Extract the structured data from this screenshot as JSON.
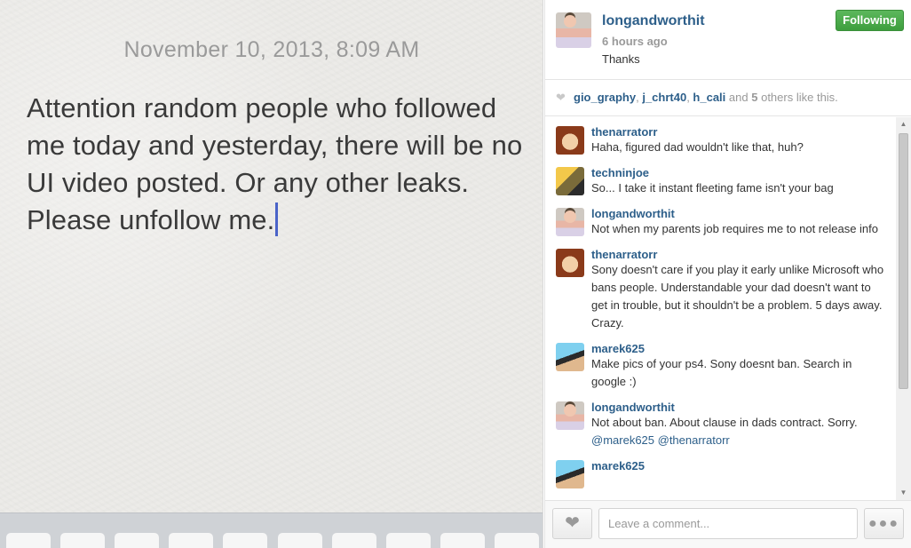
{
  "photo": {
    "date": "November 10, 2013, 8:09 AM",
    "note_text": "Attention random people who followed me today and yesterday, there will be no UI video posted. Or any other leaks. Please unfollow me."
  },
  "post": {
    "username": "longandworthit",
    "time_ago": "6 hours ago",
    "caption": "Thanks",
    "follow_label": "Following"
  },
  "likes": {
    "heart_icon": "heart-icon",
    "users": [
      "gio_graphy",
      "j_chrt40",
      "h_cali"
    ],
    "and_text": "and",
    "others_count": "5",
    "suffix": "others like this."
  },
  "comments": [
    {
      "user": "thenarratorr",
      "text": "Haha, figured dad wouldn't like that, huh?"
    },
    {
      "user": "techninjoe",
      "text": "So... I take it instant fleeting fame isn't your bag"
    },
    {
      "user": "longandworthit",
      "text": "Not when my parents job requires me to not release info"
    },
    {
      "user": "thenarratorr",
      "text": "Sony doesn't care if you play it early unlike Microsoft who bans people. Understandable your dad doesn't want to get in trouble, but it shouldn't be a problem. 5 days away. Crazy."
    },
    {
      "user": "marek625",
      "text": "Make pics of your ps4. Sony doesnt ban. Search in google :)"
    },
    {
      "user": "longandworthit",
      "text": "Not about ban. About clause in dads contract. Sorry.",
      "mentions": "@marek625 @thenarratorr"
    },
    {
      "user": "marek625",
      "text": ""
    }
  ],
  "comment_bar": {
    "placeholder": "Leave a comment...",
    "like_icon": "heart-icon",
    "more_icon": "more-dots-icon"
  },
  "colors": {
    "link_blue": "#2d5f8a",
    "follow_green": "#4cae4c",
    "caret_blue": "#4a63c8"
  }
}
